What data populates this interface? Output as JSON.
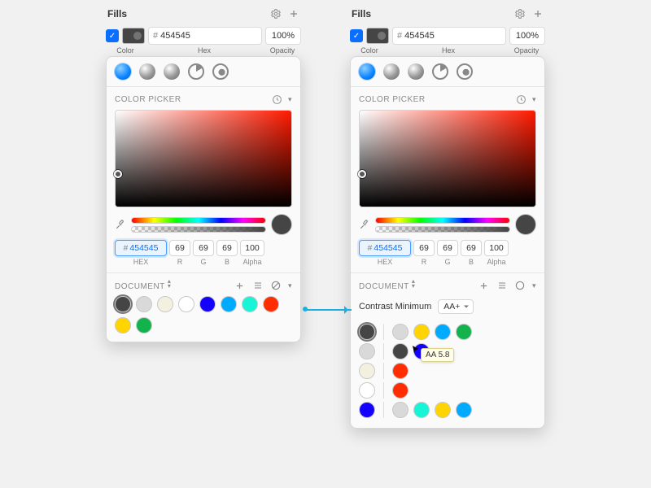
{
  "fills": {
    "title": "Fills",
    "hex": "454545",
    "opacity": "100%",
    "labels": {
      "color": "Color",
      "hex": "Hex",
      "opacity": "Opacity"
    }
  },
  "picker": {
    "heading": "COLOR PICKER",
    "hex": "454545",
    "r": "69",
    "g": "69",
    "b": "69",
    "alpha": "100",
    "labels": {
      "hex": "HEX",
      "r": "R",
      "g": "G",
      "b": "B",
      "alpha": "Alpha"
    }
  },
  "document": {
    "heading": "DOCUMENT",
    "contrast_label": "Contrast Minimum",
    "contrast_value": "AA+",
    "tooltip": "AA 5.8"
  },
  "swatches_left": [
    "#454545",
    "#d9d9d9",
    "#f3f0e0",
    "#ffffff",
    "#1400ff",
    "#00aaff",
    "#18f5d6",
    "#ff2d00",
    "#ffd400",
    "#14b24c"
  ],
  "grid_right": {
    "rows": [
      {
        "bg": "#454545",
        "fg": [
          "#d9d9d9",
          "#ffd400",
          "#00aaff",
          "#14b24c"
        ]
      },
      {
        "bg": "#d9d9d9",
        "fg": [
          "#454545",
          "#1400ff"
        ]
      },
      {
        "bg": "#f3f0e0",
        "fg": [
          "#ff2d00"
        ]
      },
      {
        "bg": "#ffffff",
        "fg": [
          "#ff2d00"
        ]
      },
      {
        "bg": "#1400ff",
        "fg": [
          "#d9d9d9",
          "#18f5d6",
          "#ffd400",
          "#00aaff"
        ]
      }
    ]
  },
  "icons": {
    "gear": "gear",
    "plus": "plus",
    "clock": "clock",
    "chev": "▾",
    "list": "list",
    "slash": "slash",
    "circle": "circle"
  }
}
